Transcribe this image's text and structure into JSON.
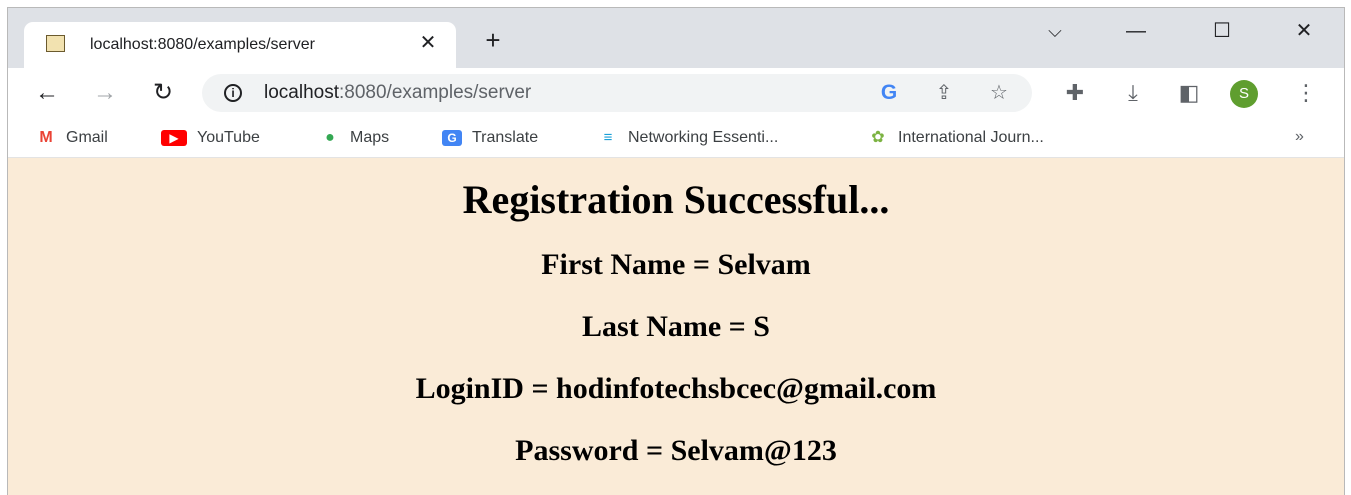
{
  "tab": {
    "title": "localhost:8080/examples/server",
    "close_glyph": "✕",
    "favicon": "tomcat-icon"
  },
  "new_tab_glyph": "+",
  "window_controls": {
    "tab_search": "⌵",
    "minimize": "—",
    "maximize": "☐",
    "close": "✕"
  },
  "toolbar": {
    "back": "←",
    "forward": "→",
    "reload": "↻",
    "info": "i",
    "url_host": "localhost",
    "url_path": ":8080/examples/server",
    "google": "G",
    "share": "⇪",
    "star": "☆",
    "extensions": "✚",
    "download": "⤓",
    "sidepanel": "◧",
    "avatar_letter": "S",
    "menu": "⋮"
  },
  "bookmarks": [
    {
      "label": "Gmail",
      "icon": "M",
      "color": "#ea4335"
    },
    {
      "label": "YouTube",
      "icon": "▶",
      "color": "#ff0000"
    },
    {
      "label": "Maps",
      "icon": "●",
      "color": "#34a853"
    },
    {
      "label": "Translate",
      "icon": "G",
      "color": "#4285f4"
    },
    {
      "label": "Networking Essenti...",
      "icon": "≡",
      "color": "#1ba0d7"
    },
    {
      "label": "International Journ...",
      "icon": "✿",
      "color": "#7cb342"
    }
  ],
  "bookmarks_more": "»",
  "page": {
    "heading": "Registration Successful...",
    "first_name": "First Name = Selvam",
    "last_name": "Last Name = S",
    "login_id": "LoginID = hodinfotechsbcec@gmail.com",
    "password": "Password = Selvam@123"
  }
}
